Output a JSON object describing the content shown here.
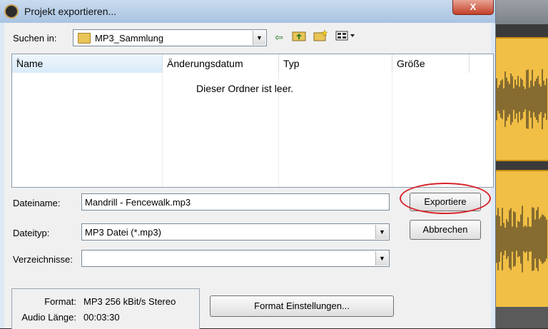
{
  "window": {
    "title": "Projekt exportieren...",
    "close_glyph": "X"
  },
  "lookin": {
    "label": "Suchen in:",
    "value": "MP3_Sammlung"
  },
  "toolbar": {
    "icons": [
      "back-icon",
      "up-folder-icon",
      "new-folder-icon",
      "view-menu-icon"
    ]
  },
  "filelist": {
    "columns": [
      "Name",
      "Änderungsdatum",
      "Typ",
      "Größe"
    ],
    "empty_message": "Dieser Ordner ist leer."
  },
  "filename": {
    "label": "Dateiname:",
    "value": "Mandrill - Fencewalk.mp3"
  },
  "filetype": {
    "label": "Dateityp:",
    "value": "MP3 Datei (*.mp3)"
  },
  "directories": {
    "label": "Verzeichnisse:",
    "value": ""
  },
  "buttons": {
    "export": "Exportiere",
    "cancel": "Abbrechen",
    "format_settings": "Format Einstellungen..."
  },
  "format_info": {
    "format_label": "Format:",
    "format_value": "MP3 256 kBit/s Stereo",
    "length_label": "Audio Länge:",
    "length_value": "00:03:30"
  },
  "colors": {
    "highlight_ring": "#d8232a",
    "audio_track": "#f1bf45"
  }
}
